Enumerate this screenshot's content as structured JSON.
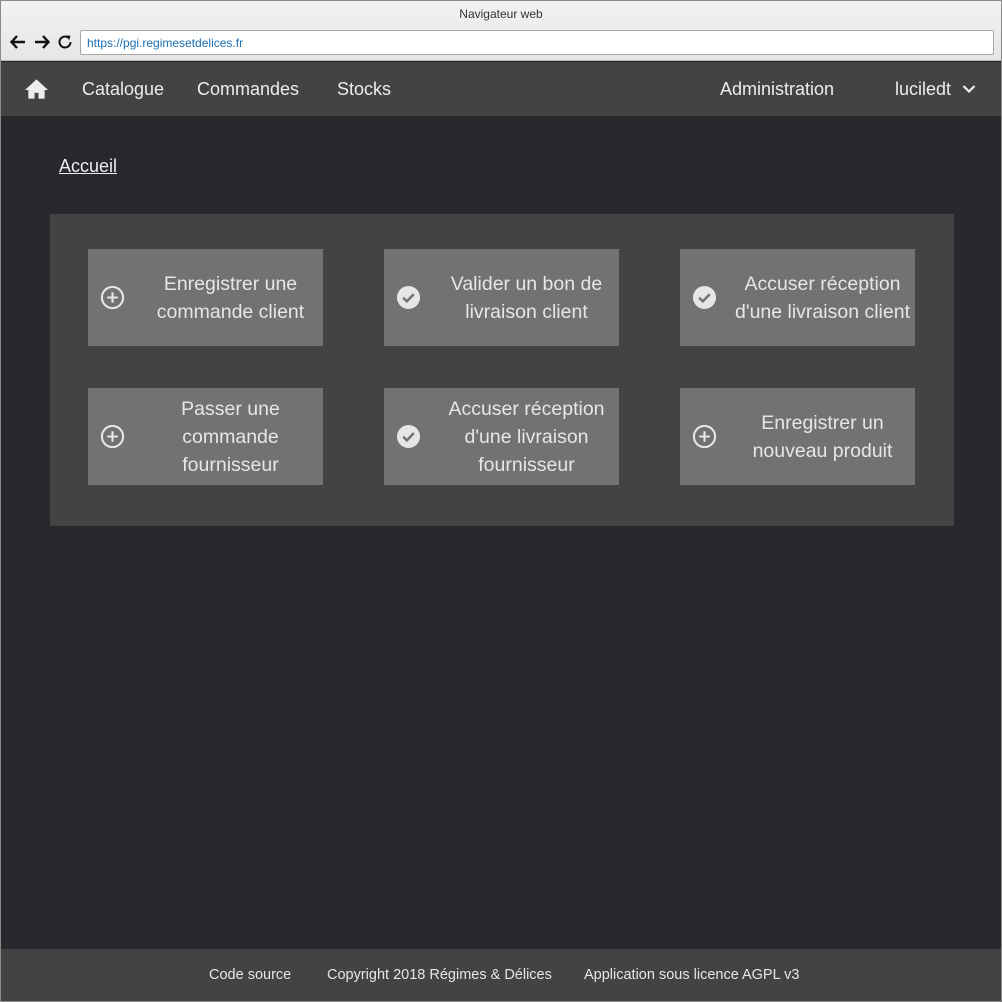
{
  "browser": {
    "title": "Navigateur web",
    "url": "https://pgi.regimesetdelices.fr"
  },
  "nav": {
    "items": [
      {
        "label": "Catalogue"
      },
      {
        "label": "Commandes"
      },
      {
        "label": "Stocks"
      }
    ],
    "admin_label": "Administration",
    "user_label": "luciledt"
  },
  "breadcrumb": {
    "label": "Accueil"
  },
  "tiles": [
    {
      "label": "Enregistrer une commande client",
      "icon": "plus-circle-icon"
    },
    {
      "label": "Valider un bon de livraison client",
      "icon": "check-circle-icon"
    },
    {
      "label": "Accuser réception d'une livraison client",
      "icon": "check-circle-icon"
    },
    {
      "label": "Passer une commande fournisseur",
      "icon": "plus-circle-icon"
    },
    {
      "label": "Accuser réception d'une livraison fournisseur",
      "icon": "check-circle-icon"
    },
    {
      "label": "Enregistrer un nouveau produit",
      "icon": "plus-circle-icon"
    }
  ],
  "footer": {
    "source_label": "Code source",
    "copyright": "Copyright 2018 Régimes & Délices",
    "license": "Application sous licence AGPL v3"
  }
}
